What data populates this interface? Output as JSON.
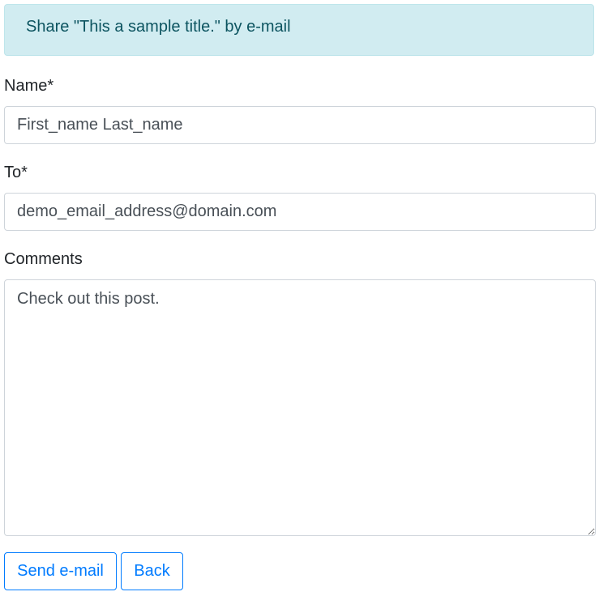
{
  "alert": {
    "text": "Share \"This a sample title.\" by e-mail"
  },
  "form": {
    "name_label": "Name*",
    "name_value": "First_name Last_name",
    "to_label": "To*",
    "to_value": "demo_email_address@domain.com",
    "comments_label": "Comments",
    "comments_value": "Check out this post."
  },
  "actions": {
    "send_label": "Send e-mail",
    "back_label": "Back"
  },
  "colors": {
    "alert_bg": "#d1ecf1",
    "alert_text": "#0c5460",
    "button_accent": "#007bff"
  }
}
